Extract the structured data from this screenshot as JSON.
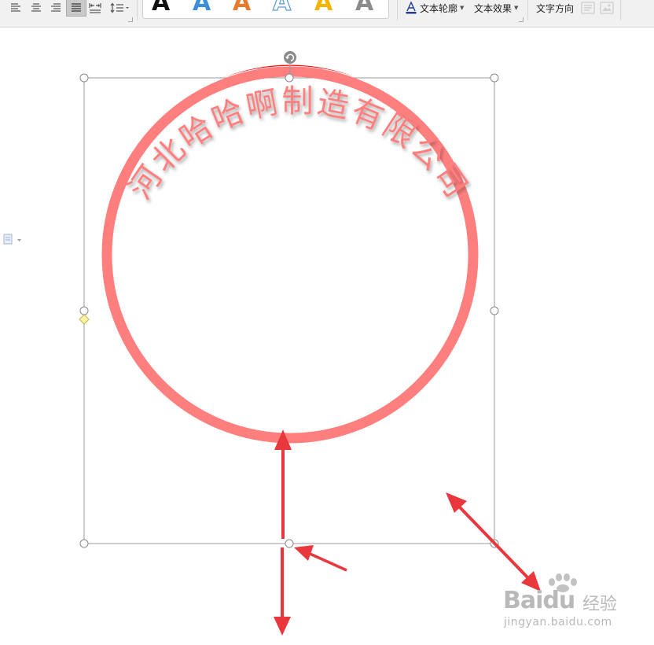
{
  "toolbar": {
    "text_outline_label": "文本轮廓",
    "text_effect_label": "文本效果",
    "text_direction_label": "文字方向",
    "gallery_letter": "A",
    "gallery_colors": [
      "#111111",
      "#3a8fd8",
      "#e87a2e",
      "#5b9bd5",
      "#f2b400",
      "#8c8c8c"
    ]
  },
  "canvas": {
    "arc_text": "河北哈哈啊制造有限公司",
    "seal_color": "#ff7f7f",
    "highlight_color": "#ff0000",
    "arrow_color": "#e8383d"
  },
  "watermark": {
    "brand": "Baidu",
    "brand_cn": "经验",
    "url": "jingyan.baidu.com"
  }
}
